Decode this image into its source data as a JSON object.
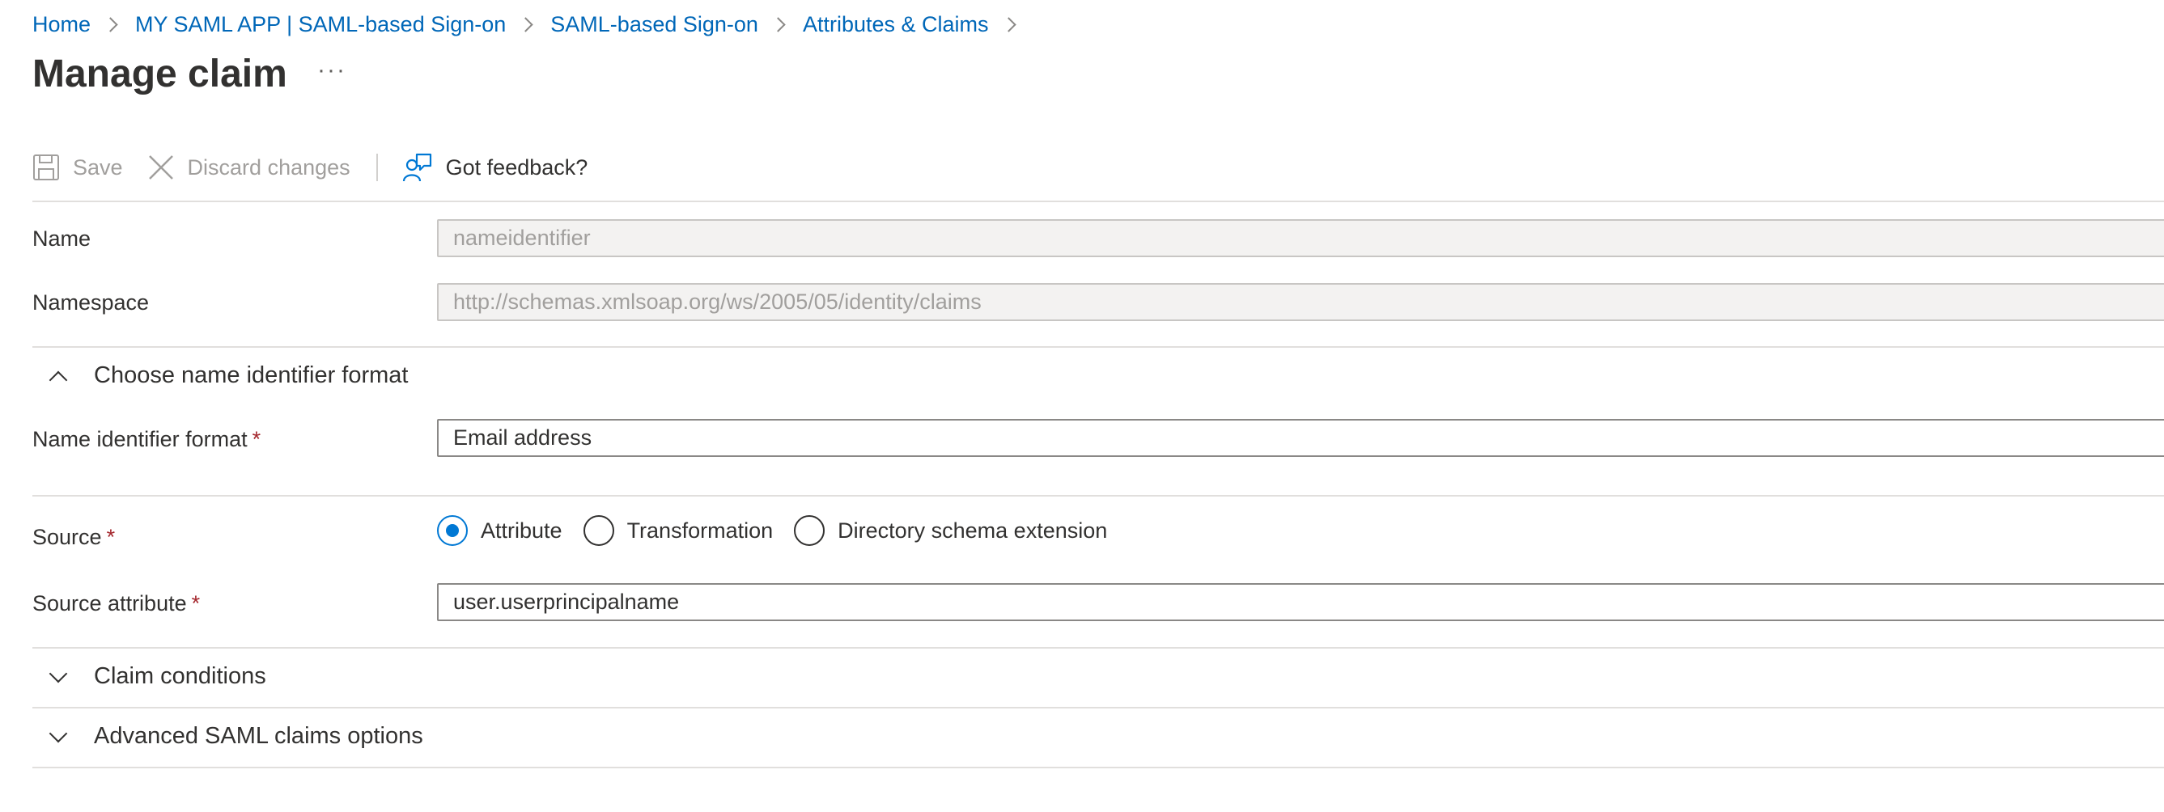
{
  "breadcrumb": [
    {
      "label": "Home"
    },
    {
      "label": "MY SAML APP | SAML-based Sign-on"
    },
    {
      "label": "SAML-based Sign-on"
    },
    {
      "label": "Attributes & Claims"
    }
  ],
  "page": {
    "title": "Manage claim",
    "more_label": "···"
  },
  "toolbar": {
    "save_label": "Save",
    "discard_label": "Discard changes",
    "feedback_label": "Got feedback?"
  },
  "form": {
    "name": {
      "label": "Name",
      "value": "nameidentifier"
    },
    "namespace": {
      "label": "Namespace",
      "value": "http://schemas.xmlsoap.org/ws/2005/05/identity/claims"
    },
    "name_id_section": {
      "label": "Choose name identifier format",
      "expanded": true
    },
    "name_id_format": {
      "label": "Name identifier format",
      "required_mark": "*",
      "value": "Email address"
    },
    "source": {
      "label": "Source",
      "required_mark": "*",
      "options": [
        {
          "label": "Attribute",
          "checked": true
        },
        {
          "label": "Transformation",
          "checked": false
        },
        {
          "label": "Directory schema extension",
          "checked": false
        }
      ]
    },
    "source_attribute": {
      "label": "Source attribute",
      "required_mark": "*",
      "value": "user.userprincipalname"
    },
    "claim_conditions": {
      "label": "Claim conditions",
      "expanded": false
    },
    "advanced_options": {
      "label": "Advanced SAML claims options",
      "expanded": false
    }
  },
  "colors": {
    "link": "#0067b8",
    "accent": "#0078d4",
    "required": "#a4262c"
  }
}
